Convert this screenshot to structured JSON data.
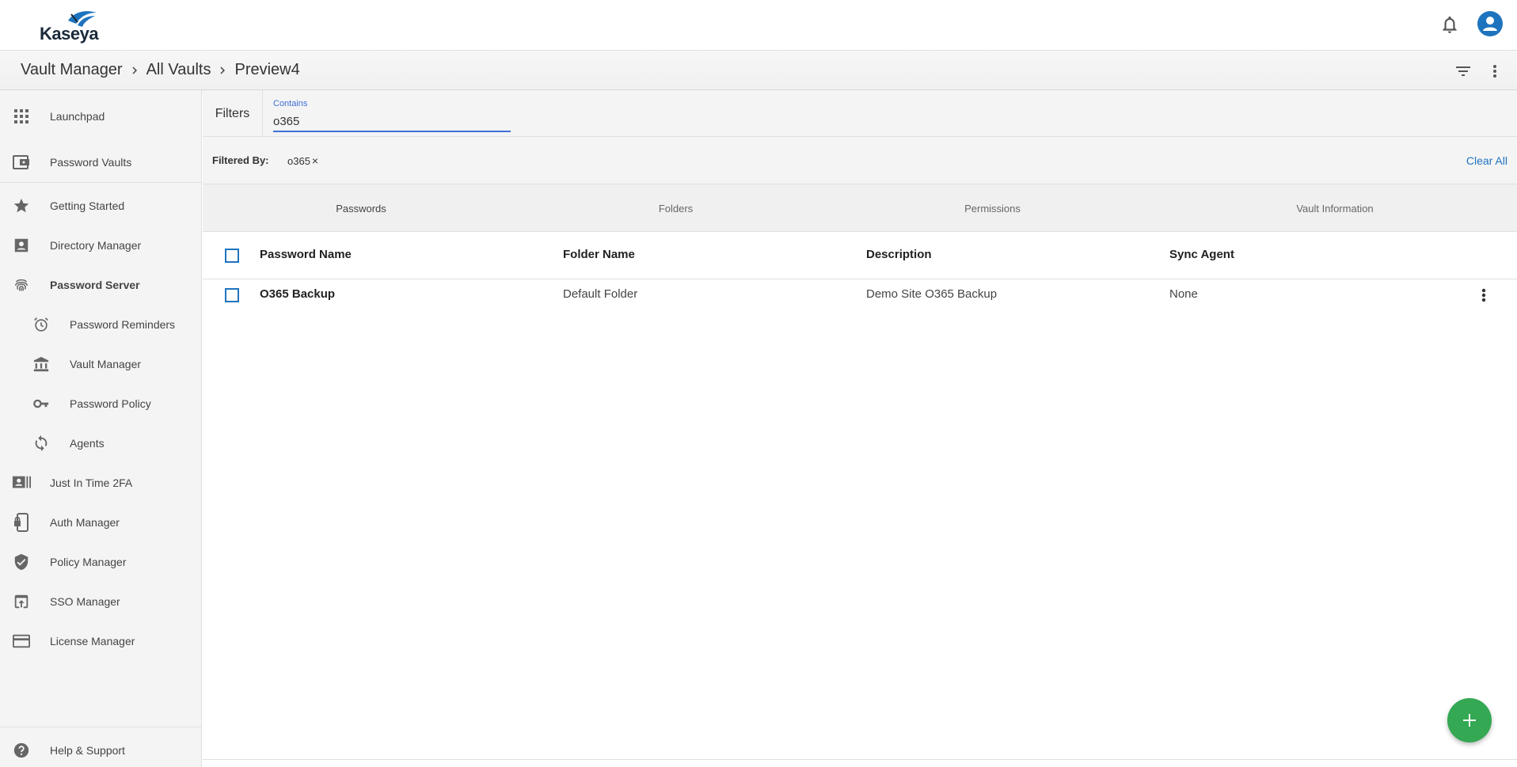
{
  "header": {
    "logo_text": "Kaseya"
  },
  "breadcrumb": {
    "items": [
      "Vault Manager",
      "All Vaults",
      "Preview4"
    ]
  },
  "sidebar": {
    "items": [
      {
        "label": "Launchpad",
        "icon": "grid-icon"
      },
      {
        "label": "Password Vaults",
        "icon": "wallet-icon"
      },
      {
        "label": "Getting Started",
        "icon": "star-icon"
      },
      {
        "label": "Directory Manager",
        "icon": "contact-card-icon"
      },
      {
        "label": "Password Server",
        "icon": "fingerprint-icon"
      },
      {
        "label": "Password Reminders",
        "icon": "alarm-icon"
      },
      {
        "label": "Vault Manager",
        "icon": "bank-icon"
      },
      {
        "label": "Password Policy",
        "icon": "key-icon"
      },
      {
        "label": "Agents",
        "icon": "sync-icon"
      },
      {
        "label": "Just In Time 2FA",
        "icon": "badge-icon"
      },
      {
        "label": "Auth Manager",
        "icon": "phone-lock-icon"
      },
      {
        "label": "Policy Manager",
        "icon": "shield-check-icon"
      },
      {
        "label": "SSO Manager",
        "icon": "open-in-browser-icon"
      },
      {
        "label": "License Manager",
        "icon": "credit-card-icon"
      }
    ],
    "help": "Help & Support"
  },
  "filters": {
    "label": "Filters",
    "contains_label": "Contains",
    "contains_value": "o365",
    "filtered_by_label": "Filtered By:",
    "chip": "o365",
    "chip_close": "×",
    "clear_all": "Clear All"
  },
  "tabs": [
    "Passwords",
    "Folders",
    "Permissions",
    "Vault Information"
  ],
  "table": {
    "columns": [
      "Password Name",
      "Folder Name",
      "Description",
      "Sync Agent"
    ],
    "rows": [
      {
        "name": "O365 Backup",
        "folder": "Default Folder",
        "description": "Demo Site O365 Backup",
        "agent": "None"
      }
    ]
  },
  "colors": {
    "accent": "#1e73be",
    "fab": "#34a853",
    "input_focus": "#3f6fd8"
  }
}
